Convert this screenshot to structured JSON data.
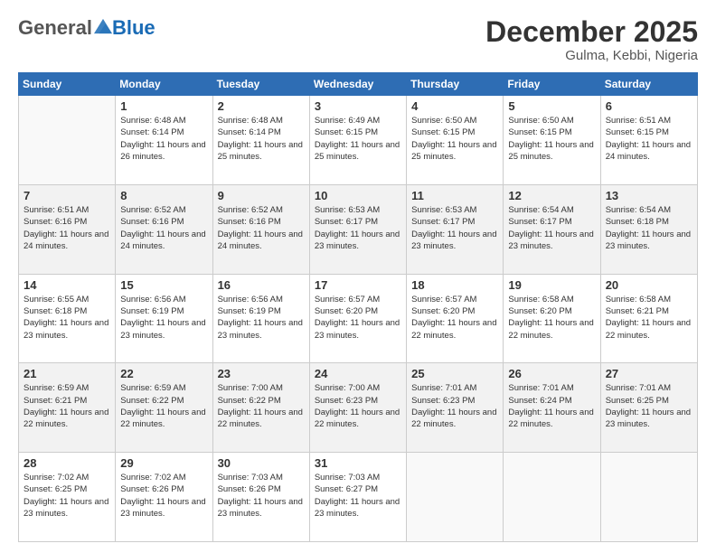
{
  "header": {
    "logo": {
      "general": "General",
      "blue": "Blue"
    },
    "title": "December 2025",
    "location": "Gulma, Kebbi, Nigeria"
  },
  "calendar": {
    "days_of_week": [
      "Sunday",
      "Monday",
      "Tuesday",
      "Wednesday",
      "Thursday",
      "Friday",
      "Saturday"
    ],
    "weeks": [
      [
        {
          "day": "",
          "empty": true
        },
        {
          "day": "1",
          "sunrise": "6:48 AM",
          "sunset": "6:14 PM",
          "daylight": "11 hours and 26 minutes."
        },
        {
          "day": "2",
          "sunrise": "6:48 AM",
          "sunset": "6:14 PM",
          "daylight": "11 hours and 25 minutes."
        },
        {
          "day": "3",
          "sunrise": "6:49 AM",
          "sunset": "6:15 PM",
          "daylight": "11 hours and 25 minutes."
        },
        {
          "day": "4",
          "sunrise": "6:50 AM",
          "sunset": "6:15 PM",
          "daylight": "11 hours and 25 minutes."
        },
        {
          "day": "5",
          "sunrise": "6:50 AM",
          "sunset": "6:15 PM",
          "daylight": "11 hours and 25 minutes."
        },
        {
          "day": "6",
          "sunrise": "6:51 AM",
          "sunset": "6:15 PM",
          "daylight": "11 hours and 24 minutes."
        }
      ],
      [
        {
          "day": "7",
          "sunrise": "6:51 AM",
          "sunset": "6:16 PM",
          "daylight": "11 hours and 24 minutes."
        },
        {
          "day": "8",
          "sunrise": "6:52 AM",
          "sunset": "6:16 PM",
          "daylight": "11 hours and 24 minutes."
        },
        {
          "day": "9",
          "sunrise": "6:52 AM",
          "sunset": "6:16 PM",
          "daylight": "11 hours and 24 minutes."
        },
        {
          "day": "10",
          "sunrise": "6:53 AM",
          "sunset": "6:17 PM",
          "daylight": "11 hours and 23 minutes."
        },
        {
          "day": "11",
          "sunrise": "6:53 AM",
          "sunset": "6:17 PM",
          "daylight": "11 hours and 23 minutes."
        },
        {
          "day": "12",
          "sunrise": "6:54 AM",
          "sunset": "6:17 PM",
          "daylight": "11 hours and 23 minutes."
        },
        {
          "day": "13",
          "sunrise": "6:54 AM",
          "sunset": "6:18 PM",
          "daylight": "11 hours and 23 minutes."
        }
      ],
      [
        {
          "day": "14",
          "sunrise": "6:55 AM",
          "sunset": "6:18 PM",
          "daylight": "11 hours and 23 minutes."
        },
        {
          "day": "15",
          "sunrise": "6:56 AM",
          "sunset": "6:19 PM",
          "daylight": "11 hours and 23 minutes."
        },
        {
          "day": "16",
          "sunrise": "6:56 AM",
          "sunset": "6:19 PM",
          "daylight": "11 hours and 23 minutes."
        },
        {
          "day": "17",
          "sunrise": "6:57 AM",
          "sunset": "6:20 PM",
          "daylight": "11 hours and 23 minutes."
        },
        {
          "day": "18",
          "sunrise": "6:57 AM",
          "sunset": "6:20 PM",
          "daylight": "11 hours and 22 minutes."
        },
        {
          "day": "19",
          "sunrise": "6:58 AM",
          "sunset": "6:20 PM",
          "daylight": "11 hours and 22 minutes."
        },
        {
          "day": "20",
          "sunrise": "6:58 AM",
          "sunset": "6:21 PM",
          "daylight": "11 hours and 22 minutes."
        }
      ],
      [
        {
          "day": "21",
          "sunrise": "6:59 AM",
          "sunset": "6:21 PM",
          "daylight": "11 hours and 22 minutes."
        },
        {
          "day": "22",
          "sunrise": "6:59 AM",
          "sunset": "6:22 PM",
          "daylight": "11 hours and 22 minutes."
        },
        {
          "day": "23",
          "sunrise": "7:00 AM",
          "sunset": "6:22 PM",
          "daylight": "11 hours and 22 minutes."
        },
        {
          "day": "24",
          "sunrise": "7:00 AM",
          "sunset": "6:23 PM",
          "daylight": "11 hours and 22 minutes."
        },
        {
          "day": "25",
          "sunrise": "7:01 AM",
          "sunset": "6:23 PM",
          "daylight": "11 hours and 22 minutes."
        },
        {
          "day": "26",
          "sunrise": "7:01 AM",
          "sunset": "6:24 PM",
          "daylight": "11 hours and 22 minutes."
        },
        {
          "day": "27",
          "sunrise": "7:01 AM",
          "sunset": "6:25 PM",
          "daylight": "11 hours and 23 minutes."
        }
      ],
      [
        {
          "day": "28",
          "sunrise": "7:02 AM",
          "sunset": "6:25 PM",
          "daylight": "11 hours and 23 minutes."
        },
        {
          "day": "29",
          "sunrise": "7:02 AM",
          "sunset": "6:26 PM",
          "daylight": "11 hours and 23 minutes."
        },
        {
          "day": "30",
          "sunrise": "7:03 AM",
          "sunset": "6:26 PM",
          "daylight": "11 hours and 23 minutes."
        },
        {
          "day": "31",
          "sunrise": "7:03 AM",
          "sunset": "6:27 PM",
          "daylight": "11 hours and 23 minutes."
        },
        {
          "day": "",
          "empty": true
        },
        {
          "day": "",
          "empty": true
        },
        {
          "day": "",
          "empty": true
        }
      ]
    ]
  }
}
